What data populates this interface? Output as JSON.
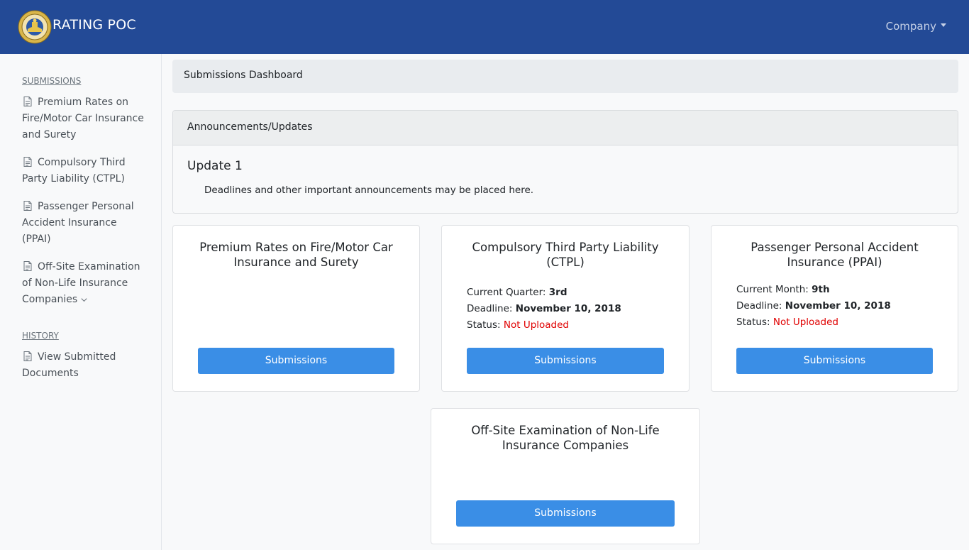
{
  "navbar": {
    "brand": "RATING POC",
    "company_menu": "Company"
  },
  "sidebar": {
    "submissions_heading": "SUBMISSIONS",
    "items": [
      {
        "label": "Premium Rates on Fire/Motor Car Insurance and Surety"
      },
      {
        "label": "Compulsory Third Party Liability (CTPL)"
      },
      {
        "label": "Passenger Personal Accident Insurance (PPAI)"
      },
      {
        "label": "Off-Site Examination of Non-Life Insurance Companies"
      }
    ],
    "history_heading": "HISTORY",
    "history_items": [
      {
        "label": "View Submitted Documents"
      }
    ]
  },
  "breadcrumb": {
    "title": "Submissions Dashboard"
  },
  "announcements": {
    "header": "Announcements/Updates",
    "title": "Update 1",
    "body": "Deadlines and other important announcements may be placed here."
  },
  "cards": [
    {
      "title": "Premium Rates on Fire/Motor Car Insurance and Surety",
      "button": "Submissions"
    },
    {
      "title": "Compulsory Third Party Liability (CTPL)",
      "period_label": "Current Quarter:",
      "period_value": "3rd",
      "deadline_label": "Deadline:",
      "deadline_value": "November 10, 2018",
      "status_label": "Status:",
      "status_value": "Not Uploaded",
      "button": "Submissions"
    },
    {
      "title": "Passenger Personal Accident Insurance (PPAI)",
      "period_label": "Current Month:",
      "period_value": "9th",
      "deadline_label": "Deadline:",
      "deadline_value": "November 10, 2018",
      "status_label": "Status:",
      "status_value": "Not Uploaded",
      "button": "Submissions"
    },
    {
      "title": "Off-Site Examination of Non-Life Insurance Companies",
      "button": "Submissions"
    }
  ],
  "colors": {
    "navbar": "#234a96",
    "button": "#3a8ee6",
    "status": "#e00000"
  },
  "icons": {
    "nav_item": "document-icon",
    "expand": "chevron-down-icon",
    "logo": "commission-seal-logo"
  }
}
